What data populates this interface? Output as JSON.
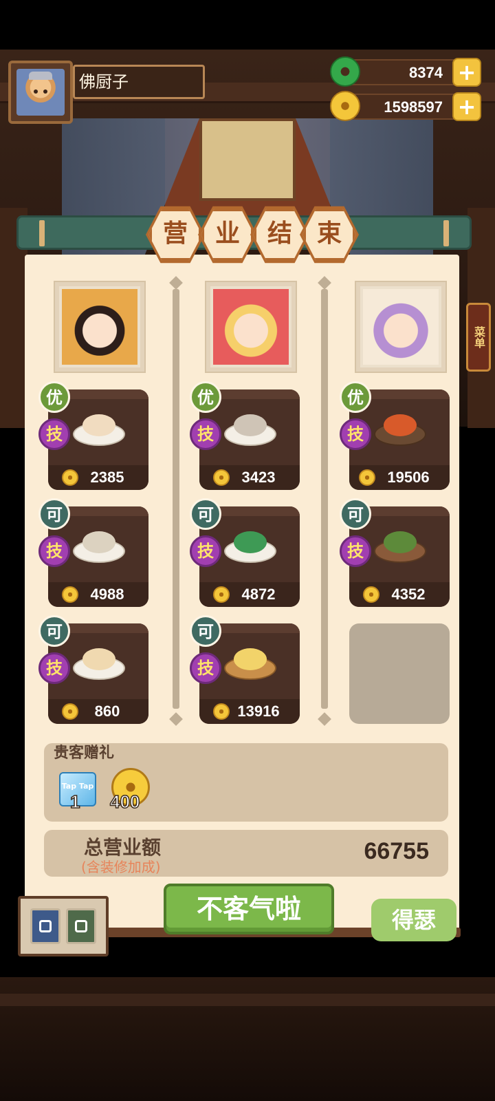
{
  "player": {
    "name": "佛厨子"
  },
  "currencies": {
    "jade": "8374",
    "coins": "1598597",
    "plus_label": "+"
  },
  "side_tab": "菜单",
  "title_chars": [
    "营",
    "业",
    "结",
    "束"
  ],
  "columns": [
    {
      "dishes": [
        {
          "grade": "优",
          "skill": "技",
          "price": "2385"
        },
        {
          "grade": "可",
          "skill": "技",
          "price": "4988"
        },
        {
          "grade": "可",
          "skill": "技",
          "price": "860"
        }
      ]
    },
    {
      "dishes": [
        {
          "grade": "优",
          "skill": "技",
          "price": "3423"
        },
        {
          "grade": "可",
          "skill": "技",
          "price": "4872"
        },
        {
          "grade": "可",
          "skill": "技",
          "price": "13916"
        }
      ]
    },
    {
      "dishes": [
        {
          "grade": "优",
          "skill": "技",
          "price": "19506"
        },
        {
          "grade": "可",
          "skill": "技",
          "price": "4352"
        }
      ]
    }
  ],
  "gifts": {
    "title": "贵客赠礼",
    "items": [
      {
        "icon": "taptap-cube-icon",
        "label": "Tap Tap",
        "count": "1"
      },
      {
        "icon": "coin-icon",
        "count": "400"
      }
    ]
  },
  "total": {
    "label": "总营业额",
    "note": "(含装修加成)",
    "value": "66755"
  },
  "buttons": {
    "primary": "不客气啦",
    "secondary": "得瑟"
  }
}
